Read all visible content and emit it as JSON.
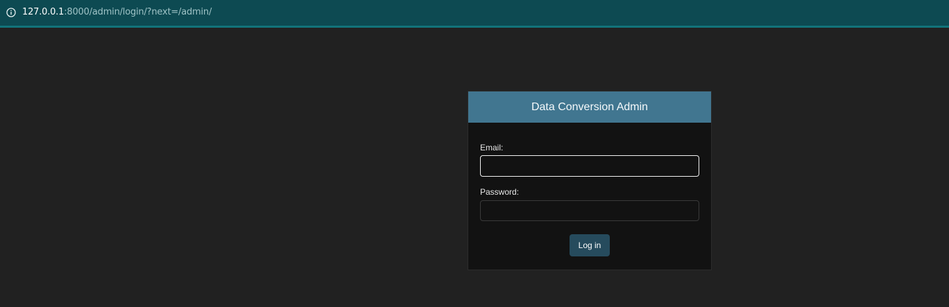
{
  "browser": {
    "url_host": "127.0.0.1",
    "url_rest": ":8000/admin/login/?next=/admin/"
  },
  "login": {
    "title": "Data Conversion Admin",
    "email_label": "Email:",
    "email_value": "",
    "password_label": "Password:",
    "password_value": "",
    "submit_label": "Log in"
  },
  "colors": {
    "page_background": "#212121",
    "browser_bar": "#0d4a52",
    "header_background": "#417690",
    "button_background": "#264b5d"
  }
}
